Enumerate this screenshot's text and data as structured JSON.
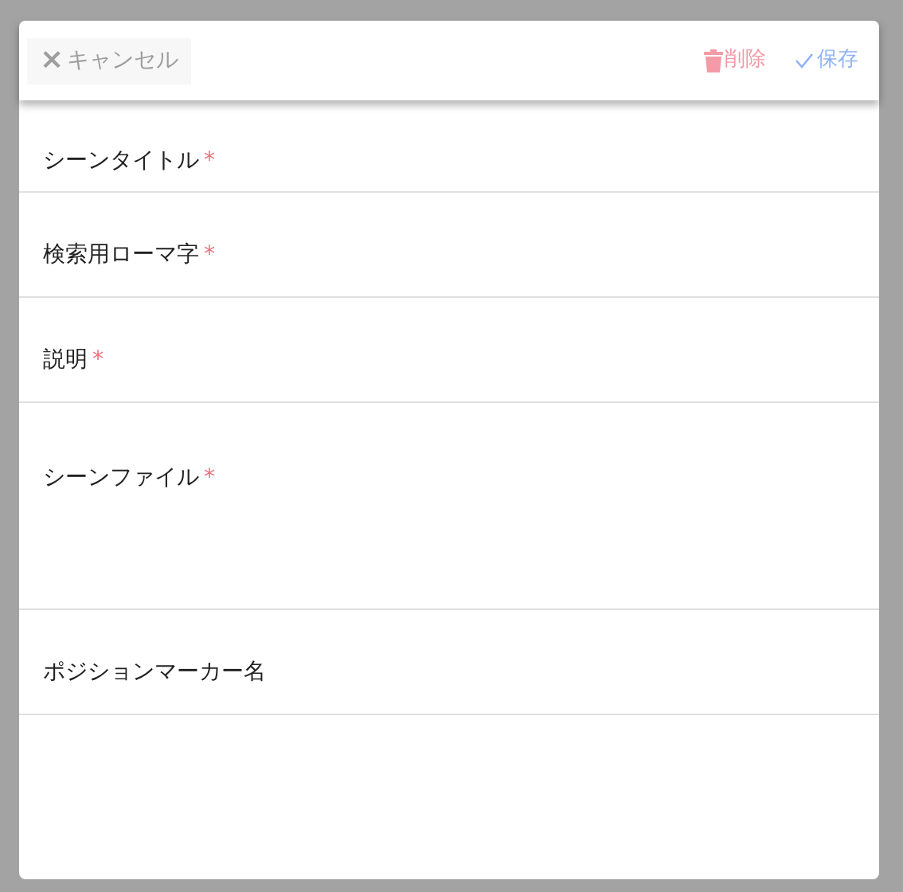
{
  "toolbar": {
    "cancel": {
      "icon": "×",
      "label": "キャンセル"
    },
    "delete": {
      "label": "削除"
    },
    "save": {
      "label": "保存"
    }
  },
  "fields": [
    {
      "kind": "text",
      "label": "シーンタイトル",
      "required": true
    },
    {
      "kind": "text",
      "label": "検索用ローマ字",
      "required": true
    },
    {
      "kind": "text",
      "label": "説明",
      "required": true
    },
    {
      "kind": "file",
      "label": "シーンファイル",
      "required": true
    },
    {
      "kind": "text",
      "label": "ポジションマーカー名",
      "required": false
    }
  ],
  "required_mark": "*"
}
